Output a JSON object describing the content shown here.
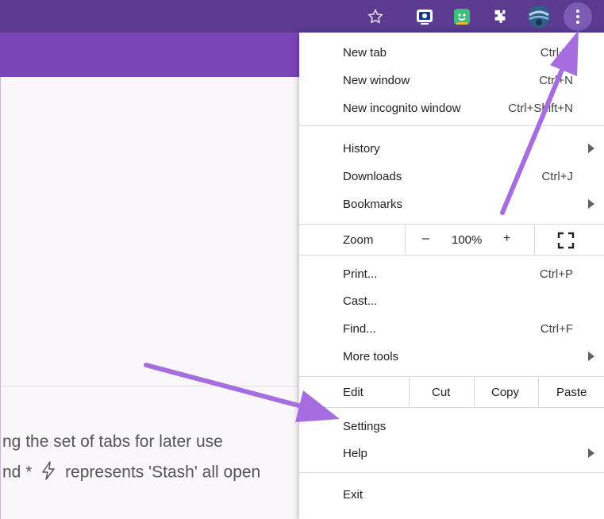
{
  "toolbar": {
    "icons": [
      "star-icon",
      "extension-screencast-icon",
      "extension-green-face-icon",
      "extensions-puzzle-icon",
      "profile-avatar-icon",
      "more-menu-icon"
    ]
  },
  "page": {
    "line1": "ng the set of tabs for later use",
    "line2_prefix": "nd *",
    "line2_suffix": "represents 'Stash' all open"
  },
  "menu": {
    "new_tab": "New tab",
    "new_tab_shortcut": "Ctrl+T",
    "new_window": "New window",
    "new_window_shortcut": "Ctrl+N",
    "new_incognito": "New incognito window",
    "new_incognito_shortcut": "Ctrl+Shift+N",
    "history": "History",
    "downloads": "Downloads",
    "downloads_shortcut": "Ctrl+J",
    "bookmarks": "Bookmarks",
    "zoom": {
      "label": "Zoom",
      "minus": "–",
      "level": "100%",
      "plus": "+"
    },
    "print": "Print...",
    "print_shortcut": "Ctrl+P",
    "cast": "Cast...",
    "find": "Find...",
    "find_shortcut": "Ctrl+F",
    "more_tools": "More tools",
    "edit": {
      "label": "Edit",
      "cut": "Cut",
      "copy": "Copy",
      "paste": "Paste"
    },
    "settings": "Settings",
    "help": "Help",
    "exit": "Exit"
  },
  "colors": {
    "toolbar": "#5a3b90",
    "band": "#7a45b7",
    "annotation_arrow": "#a66de0"
  }
}
